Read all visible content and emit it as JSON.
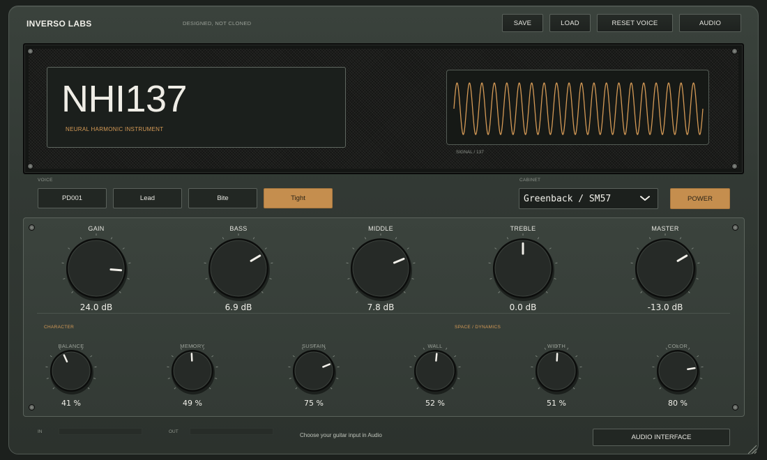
{
  "header": {
    "brand": "INVERSO LABS",
    "tagline": "DESIGNED, NOT CLONED",
    "buttons": {
      "save": "SAVE",
      "load": "LOAD",
      "reset": "RESET VOICE",
      "audio": "AUDIO"
    }
  },
  "display": {
    "name": "NHI137",
    "subtitle": "NEURAL HARMONIC INSTRUMENT",
    "signal_label": "SIGNAL / 137",
    "waveform_cycles": 20,
    "waveform_color": "#d59a56"
  },
  "voice": {
    "label": "VOICE",
    "options": [
      "PD001",
      "Lead",
      "Bite",
      "Tight"
    ],
    "selected": "Tight"
  },
  "cabinet": {
    "label": "CABINET",
    "value": "Greenback / SM57",
    "chevron_icon": "chevron-down-icon"
  },
  "power": {
    "label": "POWER",
    "on": true
  },
  "accent_color": "#c58e4e",
  "main_knobs": [
    {
      "label": "GAIN",
      "value": "24.0 dB",
      "level": 0.85
    },
    {
      "label": "BASS",
      "value": "6.9 dB",
      "level": 0.72
    },
    {
      "label": "MIDDLE",
      "value": "7.8 dB",
      "level": 0.75
    },
    {
      "label": "TREBLE",
      "value": "0.0 dB",
      "level": 0.5
    },
    {
      "label": "MASTER",
      "value": "-13.0 dB",
      "level": 0.72
    }
  ],
  "sections": {
    "character": "CHARACTER",
    "space": "SPACE / DYNAMICS"
  },
  "small_knobs": [
    {
      "label": "BALANCE",
      "value": "41 %",
      "level": 0.41
    },
    {
      "label": "MEMORY",
      "value": "49 %",
      "level": 0.49
    },
    {
      "label": "SUSTAIN",
      "value": "75 %",
      "level": 0.75
    },
    {
      "label": "WALL",
      "value": "52 %",
      "level": 0.52
    },
    {
      "label": "WIDTH",
      "value": "51 %",
      "level": 0.51
    },
    {
      "label": "COLOR",
      "value": "80 %",
      "level": 0.8
    }
  ],
  "footer": {
    "in_label": "IN",
    "out_label": "OUT",
    "hint": "Choose your guitar input in Audio",
    "audio_interface": "AUDIO INTERFACE"
  }
}
